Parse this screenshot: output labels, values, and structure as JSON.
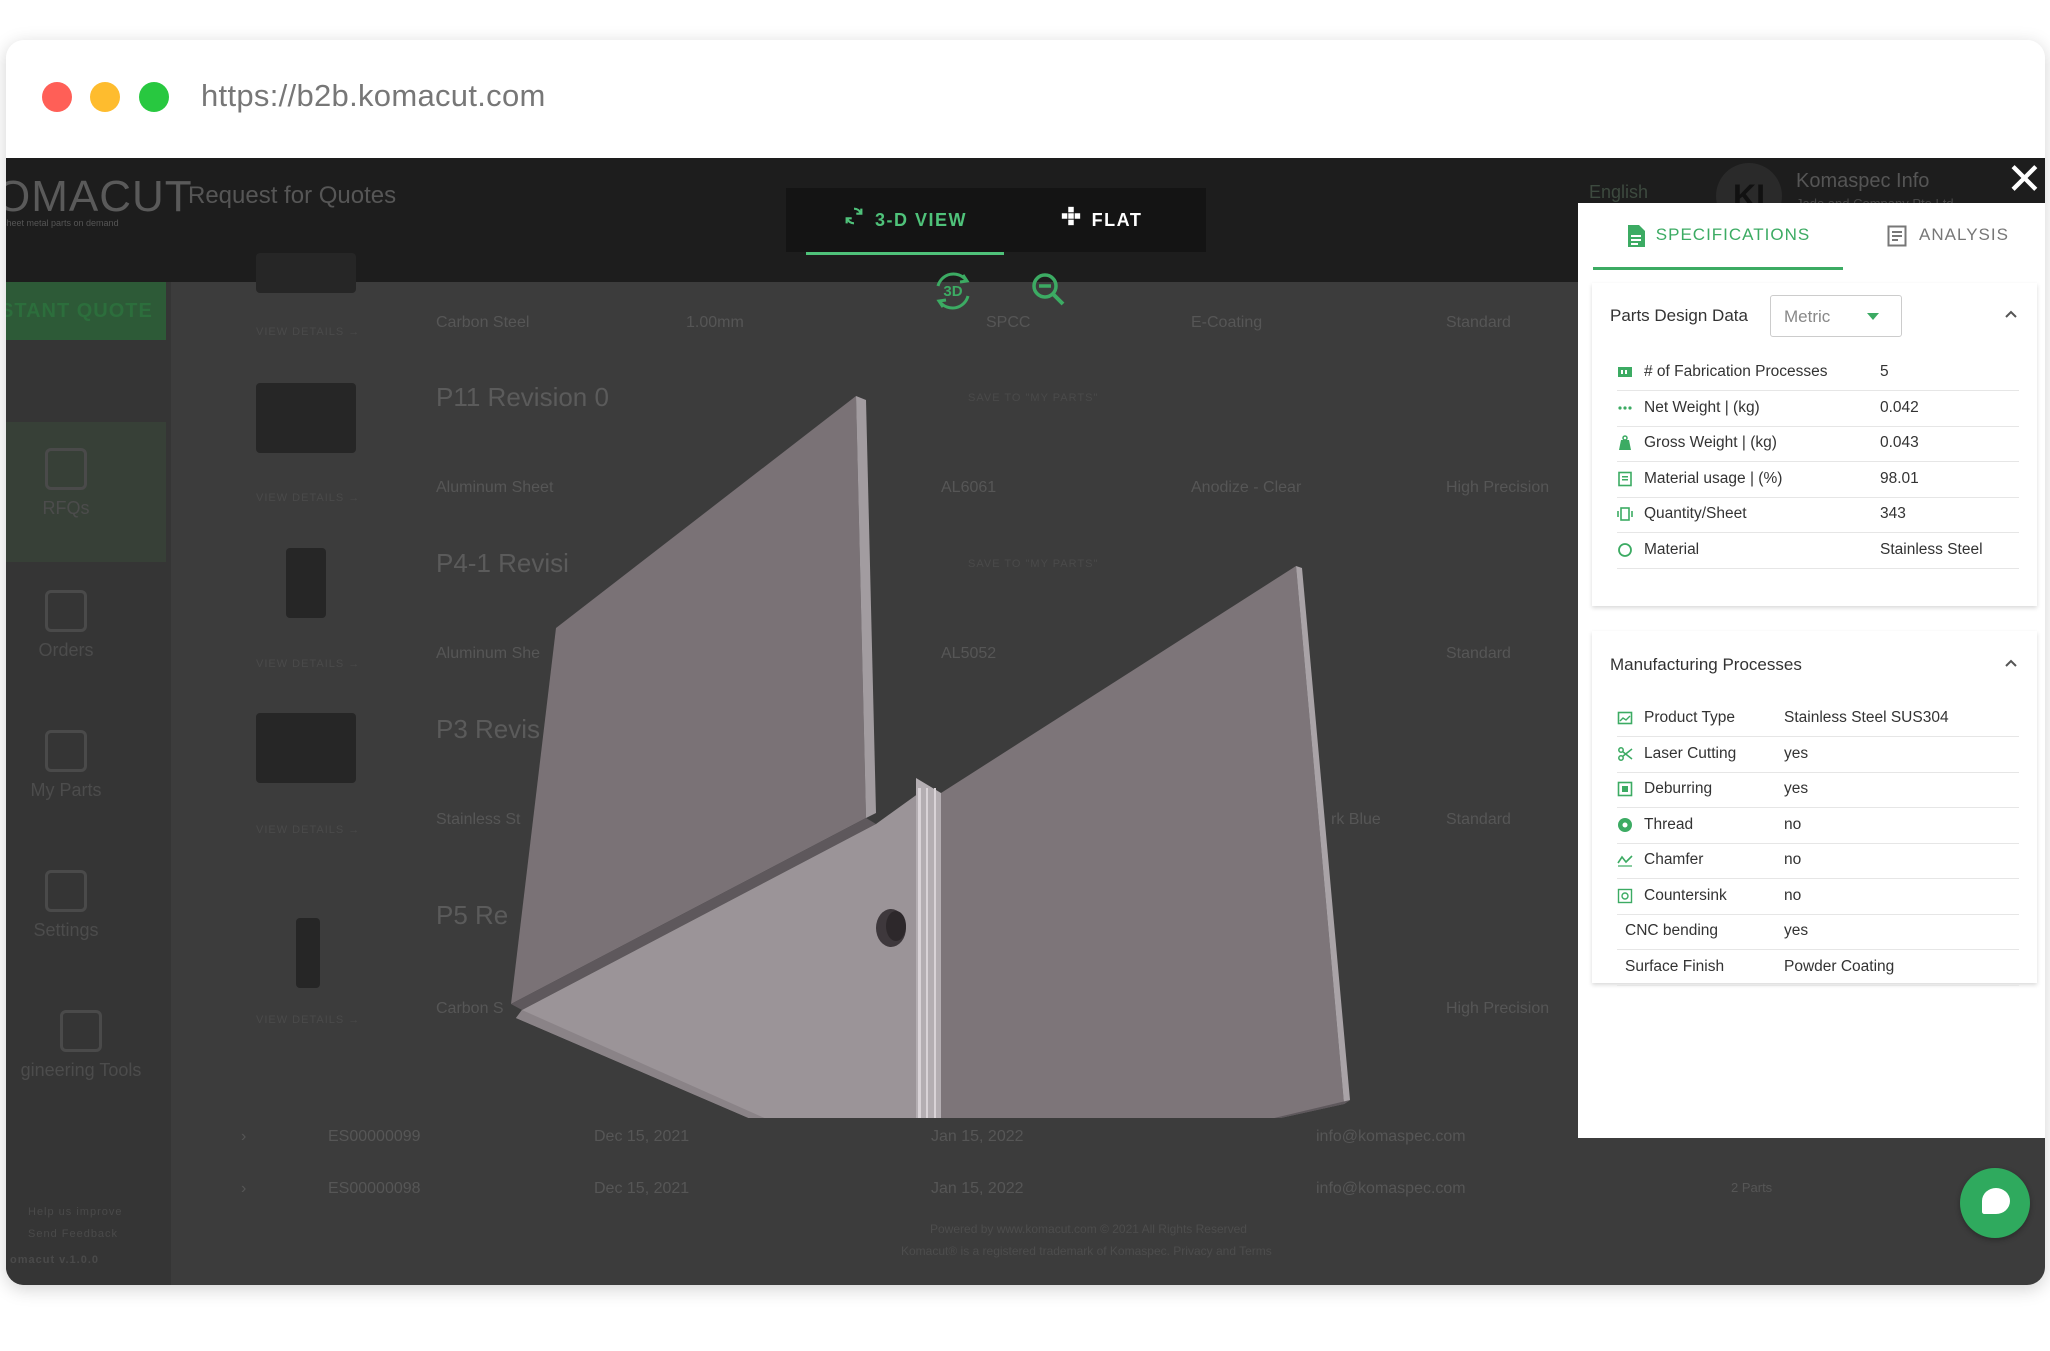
{
  "browser": {
    "url": "https://b2b.komacut.com"
  },
  "background_app": {
    "logo": "OMACUT",
    "logo_sub": "sheet metal parts on demand",
    "page_title": "Request for Quotes",
    "language": "English",
    "user_initials": "KI",
    "user_name": "Komaspec Info",
    "user_company": "Jade and Company Pte Ltd",
    "instant_quote": "STANT QUOTE",
    "nav": [
      "RFQs",
      "Orders",
      "My Parts",
      "Settings",
      "gineering Tools"
    ],
    "help": "Help us improve",
    "feedback": "Send Feedback",
    "version": "omacut v.1.0.0",
    "view_details": "VIEW DETAILS →",
    "save_to_parts": "SAVE TO \"MY PARTS\"",
    "parts": [
      {
        "name": "",
        "material": "Carbon Steel",
        "thickness": "1.00mm",
        "series": "SPCC",
        "finish": "E-Coating",
        "tolerance": "Standard"
      },
      {
        "name": "P11 Revision 0",
        "material": "Aluminum Sheet",
        "series": "AL6061",
        "finish": "Anodize - Clear",
        "tolerance": "High Precision"
      },
      {
        "name": "P4-1 Revisi",
        "material": "Aluminum She",
        "series": "AL5052",
        "tolerance": "Standard"
      },
      {
        "name": "P3 Revis",
        "material": "Stainless St",
        "finish": "rk Blue",
        "tolerance": "Standard"
      },
      {
        "name": "P5 Re",
        "material": "Carbon S",
        "tolerance": "High Precision"
      }
    ],
    "orders": [
      {
        "id": "ES00000099",
        "date1": "Dec 15, 2021",
        "date2": "Jan 15, 2022",
        "email": "info@komaspec.com",
        "parts": ""
      },
      {
        "id": "ES00000098",
        "date1": "Dec 15, 2021",
        "date2": "Jan 15, 2022",
        "email": "info@komaspec.com",
        "parts": "2 Parts"
      }
    ],
    "footer1": "Powered by www.komacut.com © 2021 All Rights Reserved",
    "footer2": "Komacut® is a registered trademark of Komaspec. Privacy and Terms"
  },
  "viewer": {
    "tabs": [
      {
        "label": "3-D VIEW",
        "active": true
      },
      {
        "label": "FLAT",
        "active": false
      }
    ],
    "ctrl_3d_label": "3D",
    "close_glyph": "✕"
  },
  "panel": {
    "tabs": [
      {
        "label": "SPECIFICATIONS",
        "active": true
      },
      {
        "label": "ANALYSIS",
        "active": false
      }
    ],
    "design": {
      "title": "Parts Design Data",
      "unit": "Metric",
      "rows": [
        {
          "label": "# of Fabrication Processes",
          "value": "5",
          "icon": "processes-icon"
        },
        {
          "label": "Net Weight | (kg)",
          "value": "0.042",
          "icon": "dots-icon"
        },
        {
          "label": "Gross Weight | (kg)",
          "value": "0.043",
          "icon": "weight-icon"
        },
        {
          "label": "Material usage | (%)",
          "value": "98.01",
          "icon": "usage-icon"
        },
        {
          "label": "Quantity/Sheet",
          "value": "343",
          "icon": "sheet-icon"
        },
        {
          "label": "Material",
          "value": "Stainless Steel",
          "icon": "material-icon"
        }
      ]
    },
    "manufacturing": {
      "title": "Manufacturing Processes",
      "rows": [
        {
          "label": "Product Type",
          "value": "Stainless Steel SUS304",
          "icon": "product-icon"
        },
        {
          "label": "Laser Cutting",
          "value": "yes",
          "icon": "scissors-icon"
        },
        {
          "label": "Deburring",
          "value": "yes",
          "icon": "deburring-icon"
        },
        {
          "label": "Thread",
          "value": "no",
          "icon": "thread-icon"
        },
        {
          "label": "Chamfer",
          "value": "no",
          "icon": "chamfer-icon"
        },
        {
          "label": "Countersink",
          "value": "no",
          "icon": "countersink-icon"
        },
        {
          "label": "CNC bending",
          "value": "yes",
          "icon": ""
        },
        {
          "label": "Surface Finish",
          "value": "Powder Coating",
          "icon": ""
        }
      ]
    }
  },
  "colors": {
    "accent": "#3cab63",
    "overlay": "#3c3c3c",
    "chat": "#2faa5e"
  }
}
